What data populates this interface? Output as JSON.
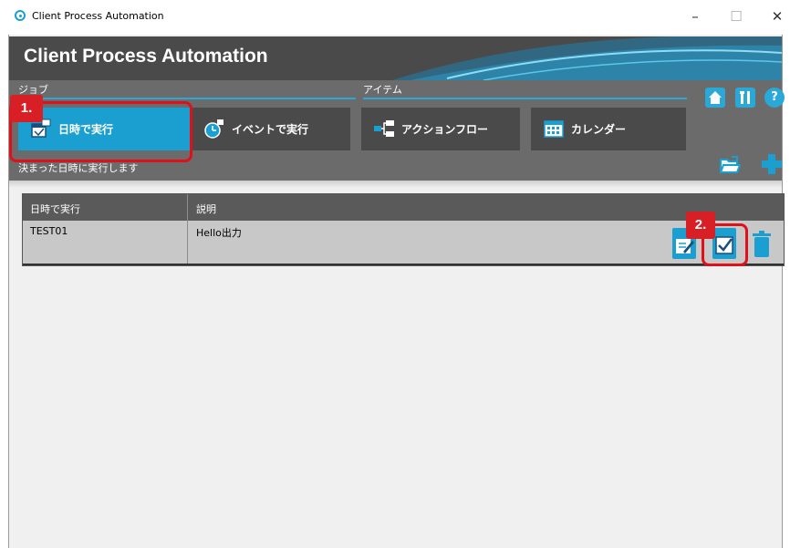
{
  "window": {
    "title": "Client Process Automation",
    "minimize": "–",
    "maximize": "☐",
    "close": "✕"
  },
  "banner": {
    "title": "Client Process Automation"
  },
  "nav": {
    "section_job": "ジョブ",
    "section_item": "アイテム",
    "tiles": [
      {
        "label": "日時で実行",
        "icon": "calendar-clock-icon",
        "active": true
      },
      {
        "label": "イベントで実行",
        "icon": "clock-event-icon",
        "active": false
      },
      {
        "label": "アクションフロー",
        "icon": "flow-icon",
        "active": false
      },
      {
        "label": "カレンダー",
        "icon": "calendar-icon",
        "active": false
      }
    ],
    "description": "決まった日時に実行します",
    "top_icons": [
      "home-icon",
      "tools-icon",
      "help-icon"
    ],
    "help_label": "?"
  },
  "table": {
    "headers": [
      "日時で実行",
      "説明"
    ],
    "rows": [
      {
        "name": "TEST01",
        "description": "Hello出力"
      }
    ]
  },
  "markers": [
    "1.",
    "2."
  ],
  "colors": {
    "accent": "#1a9fd0",
    "marker": "#e0101a",
    "banner": "#4a4a4a",
    "nav": "#6b6b6b"
  }
}
